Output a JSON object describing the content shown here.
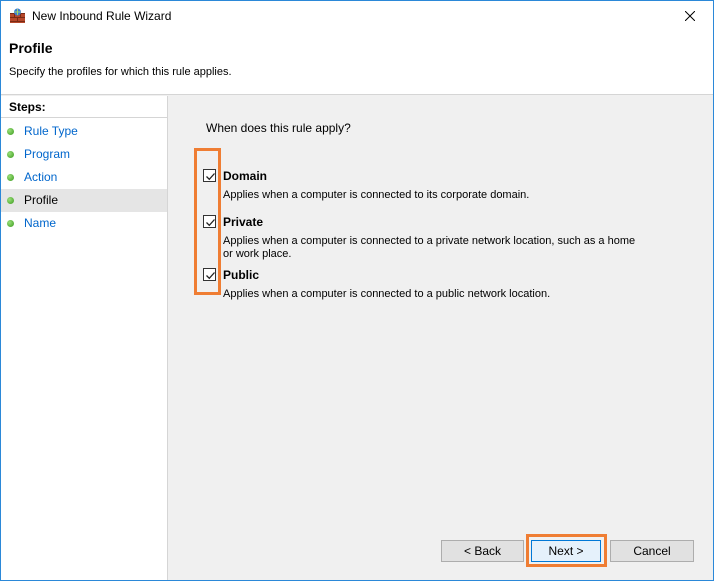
{
  "window": {
    "title": "New Inbound Rule Wizard",
    "accent_color": "#2b88d8",
    "icon": "firewall-icon"
  },
  "header": {
    "title": "Profile",
    "subtitle": "Specify the profiles for which this rule applies."
  },
  "steps": {
    "title": "Steps:",
    "items": [
      {
        "label": "Rule Type",
        "active": false
      },
      {
        "label": "Program",
        "active": false
      },
      {
        "label": "Action",
        "active": false
      },
      {
        "label": "Profile",
        "active": true
      },
      {
        "label": "Name",
        "active": false
      }
    ]
  },
  "content": {
    "question": "When does this rule apply?",
    "options": [
      {
        "label": "Domain",
        "checked": true,
        "desc": "Applies when a computer is connected to its corporate domain."
      },
      {
        "label": "Private",
        "checked": true,
        "desc_line1": "Applies when a computer is connected to a private network location, such as a home",
        "desc_line2": "or work place."
      },
      {
        "label": "Public",
        "checked": true,
        "desc": "Applies when a computer is connected to a public network location."
      }
    ]
  },
  "buttons": {
    "back": "< Back",
    "next": "Next >",
    "cancel": "Cancel"
  },
  "highlight_color": "#ef7d33"
}
